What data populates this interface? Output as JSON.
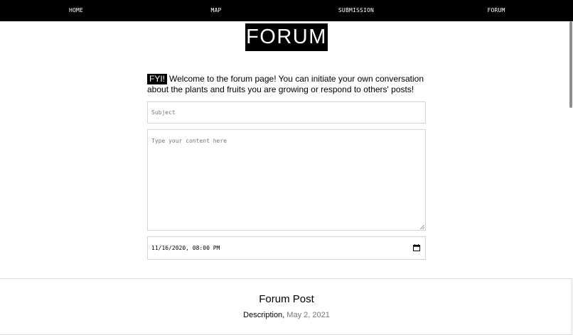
{
  "nav": {
    "items": [
      {
        "label": "HOME"
      },
      {
        "label": "MAP"
      },
      {
        "label": "SUBMISSION"
      },
      {
        "label": "FORUM"
      }
    ]
  },
  "page_title": "FORUM",
  "intro": {
    "badge": "FYI!",
    "text": "Welcome to the forum page! You can initiate your own conversation about the plants and fruits you are growing or respond to others' posts!"
  },
  "form": {
    "subject_placeholder": "Subject",
    "content_placeholder": "Type your content here",
    "datetime_value": "11/16/2020, 08:00 PM"
  },
  "post": {
    "title": "Forum Post",
    "description_label": "Description,",
    "date": "May 2, 2021"
  },
  "icons": {
    "calendar": "calendar-icon",
    "resize": "resize-handle-icon"
  }
}
